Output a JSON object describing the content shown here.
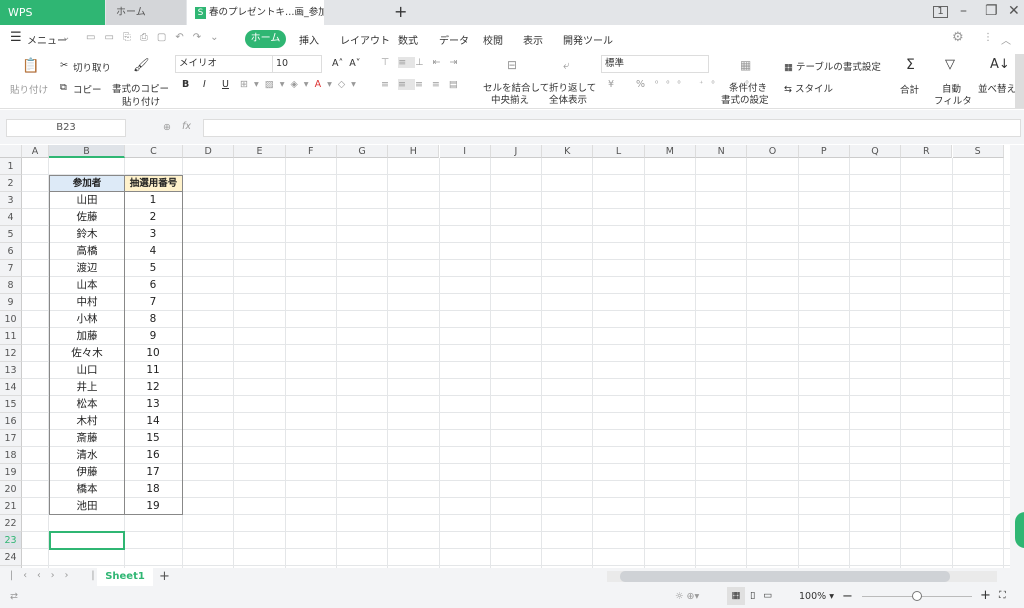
{
  "titlebar": {
    "app": "WPS Spreadsheets",
    "home_tab": "ホーム",
    "doc_tab": "春のプレゼントキ…画_参加者リスト",
    "new_tab": "+"
  },
  "menu": {
    "menu_label": "メニュー",
    "tabs": [
      "ホーム",
      "挿入",
      "レイアウト",
      "数式",
      "データ",
      "校閲",
      "表示",
      "開発ツール"
    ],
    "active_tab": "ホーム"
  },
  "ribbon": {
    "paste": "貼り付け",
    "cut": "切り取り",
    "copy": "コピー",
    "format_copy_1": "書式のコピー",
    "format_copy_2": "貼り付け",
    "font": "メイリオ",
    "size": "10",
    "merge_1": "セルを結合して",
    "merge_2": "中央揃え",
    "wrap_1": "折り返して",
    "wrap_2": "全体表示",
    "number_format": "標準",
    "cond_1": "条件付き",
    "cond_2": "書式の設定",
    "table_format": "テーブルの書式設定",
    "style": "スタイル",
    "sum": "合計",
    "filter_1": "自動",
    "filter_2": "フィルタ",
    "sort": "並べ替え",
    "bold": "B",
    "italic": "I",
    "underline": "U",
    "yen": "¥",
    "percent": "%"
  },
  "formula_bar": {
    "name_box": "B23",
    "fx": "fx",
    "value": ""
  },
  "columns": [
    "A",
    "B",
    "C",
    "D",
    "E",
    "F",
    "G",
    "H",
    "I",
    "J",
    "K",
    "L",
    "M",
    "N",
    "O",
    "P",
    "Q",
    "R",
    "S"
  ],
  "table": {
    "headers": [
      "参加者",
      "抽選用番号"
    ],
    "rows": [
      [
        "山田",
        "1"
      ],
      [
        "佐藤",
        "2"
      ],
      [
        "鈴木",
        "3"
      ],
      [
        "高橋",
        "4"
      ],
      [
        "渡辺",
        "5"
      ],
      [
        "山本",
        "6"
      ],
      [
        "中村",
        "7"
      ],
      [
        "小林",
        "8"
      ],
      [
        "加藤",
        "9"
      ],
      [
        "佐々木",
        "10"
      ],
      [
        "山口",
        "11"
      ],
      [
        "井上",
        "12"
      ],
      [
        "松本",
        "13"
      ],
      [
        "木村",
        "14"
      ],
      [
        "斎藤",
        "15"
      ],
      [
        "清水",
        "16"
      ],
      [
        "伊藤",
        "17"
      ],
      [
        "橋本",
        "18"
      ],
      [
        "池田",
        "19"
      ]
    ]
  },
  "selected_cell": "B23",
  "sheets": {
    "tabs": [
      "Sheet1"
    ],
    "active": "Sheet1",
    "add": "+"
  },
  "status": {
    "zoom": "100%",
    "zoom_level": 0.5
  },
  "colors": {
    "accent": "#2fb673",
    "header_fill": "#ddeaf7",
    "number_header_fill": "#fff2cc"
  }
}
